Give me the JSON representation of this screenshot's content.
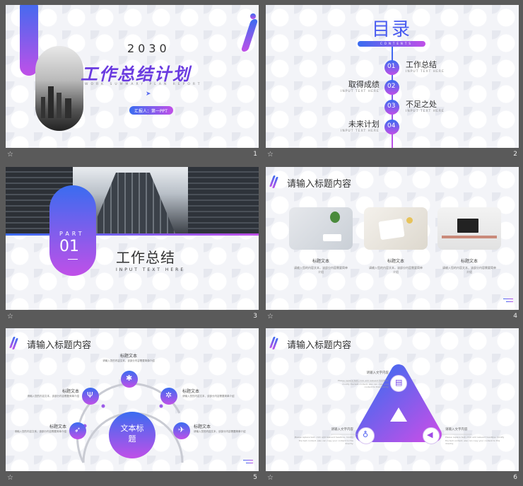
{
  "slides": [
    {
      "num": "1",
      "year": "2030",
      "title": "工作总结计划",
      "subtitle": "WORK SUMMARY PLAN REPORT",
      "reporter": "汇报人：第一PPT"
    },
    {
      "num": "2",
      "title": "目录",
      "contents": "CONTENTS",
      "items": [
        {
          "n": "01",
          "label": "工作总结",
          "sub": "INPUT TEXT HERE"
        },
        {
          "n": "02",
          "label": "取得成绩",
          "sub": "INPUT TEXT HERE"
        },
        {
          "n": "03",
          "label": "不足之处",
          "sub": "INPUT TEXT HERE"
        },
        {
          "n": "04",
          "label": "未来计划",
          "sub": "INPUT TEXT HERE"
        }
      ]
    },
    {
      "num": "3",
      "part": "PART",
      "part_num": "01",
      "title": "工作总结",
      "sub": "INPUT TEXT HERE"
    },
    {
      "num": "4",
      "heading": "请输入标题内容",
      "cards": [
        {
          "label": "标题文本",
          "desc": "请输入您的内容文本，该部分内容需要简单介绍"
        },
        {
          "label": "标题文本",
          "desc": "请输入您的内容文本，该部分内容需要简单介绍"
        },
        {
          "label": "标题文本",
          "desc": "请输入您的内容文本，该部分内容需要简单介绍"
        }
      ]
    },
    {
      "num": "5",
      "heading": "请输入标题内容",
      "center": "文本标题",
      "nodes": [
        {
          "label": "标题文本",
          "desc": "请输入您的内容文本，该部分内容需要简单介绍"
        },
        {
          "label": "标题文本",
          "desc": "请输入您的内容文本，该部分内容需要简单介绍"
        },
        {
          "label": "标题文本",
          "desc": "请输入您的内容文本，该部分内容需要简单介绍"
        },
        {
          "label": "标题文本",
          "desc": "请输入您的内容文本，该部分内容需要简单介绍"
        },
        {
          "label": "标题文本",
          "desc": "请输入您的内容文本，该部分内容需要简单介绍"
        }
      ]
    },
    {
      "num": "6",
      "heading": "请输入标题内容",
      "blocks": [
        {
          "label": "请输入文字内容",
          "desc": "Please replace text, click add relevant headline, modify the text content, also can copy your content to this directly."
        },
        {
          "label": "请输入文字内容",
          "desc": "Please replace text, click add relevant headline, modify the text content, also can copy your content to this directly."
        },
        {
          "label": "请输入文字内容",
          "desc": "Please replace text, click add relevant headline, modify the text content, also can copy your content to this directly."
        }
      ]
    }
  ],
  "star_icon": "star-icon",
  "accent_blue": "#3a6cf0",
  "accent_purple": "#c050e8"
}
